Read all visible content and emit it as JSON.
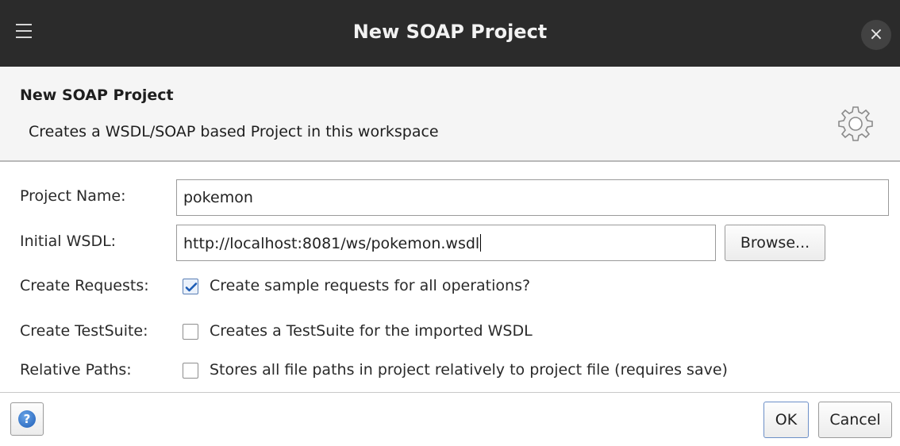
{
  "window": {
    "title": "New SOAP Project",
    "menu_icon": "hamburger-menu-icon",
    "close_symbol": "×"
  },
  "header": {
    "title": "New SOAP Project",
    "description": "Creates a WSDL/SOAP based Project in this workspace",
    "icon": "gear-icon"
  },
  "form": {
    "project_name": {
      "label": "Project Name:",
      "value": "pokemon"
    },
    "initial_wsdl": {
      "label": "Initial WSDL:",
      "value": "http://localhost:8081/ws/pokemon.wsdl",
      "browse_label": "Browse..."
    },
    "create_requests": {
      "label": "Create Requests:",
      "text": "Create sample requests for all operations?",
      "checked": true
    },
    "create_testsuite": {
      "label": "Create TestSuite:",
      "text": "Creates a TestSuite for the imported WSDL",
      "checked": false
    },
    "relative_paths": {
      "label": "Relative Paths:",
      "text": "Stores all file paths in project relatively to project file (requires save)",
      "checked": false
    }
  },
  "footer": {
    "help_symbol": "?",
    "ok_label": "OK",
    "cancel_label": "Cancel"
  },
  "colors": {
    "titlebar": "#2b2b2b",
    "header_bg": "#f5f5f5",
    "check_accent": "#1d5db6"
  }
}
